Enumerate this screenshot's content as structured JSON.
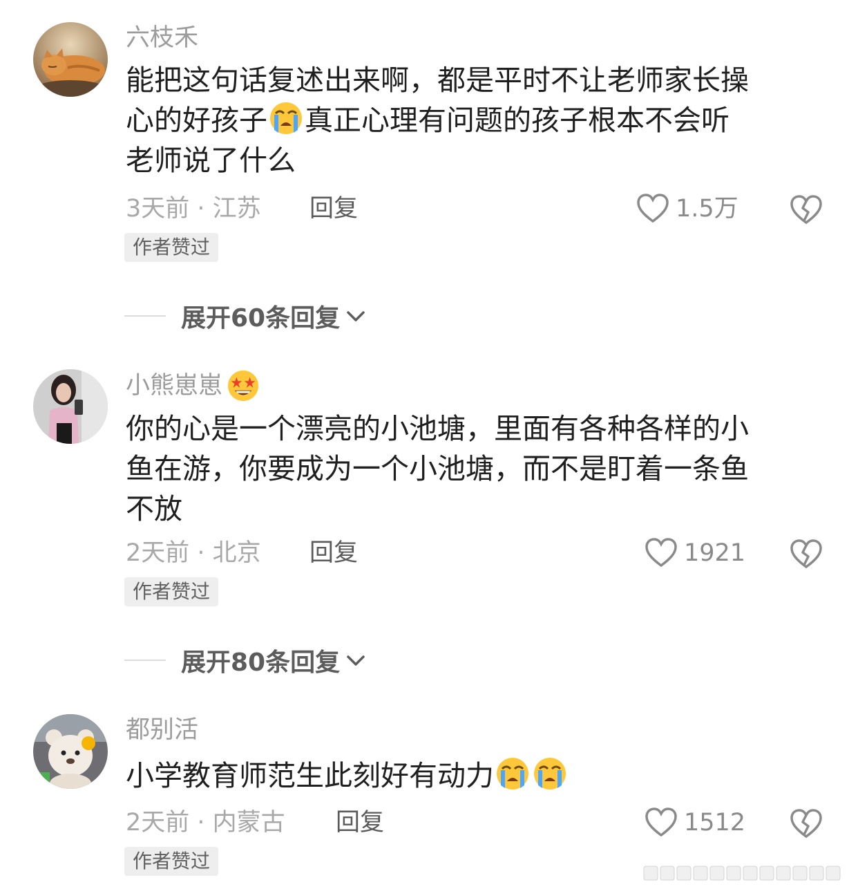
{
  "comments": [
    {
      "username": "六枝禾",
      "avatar_icon": "cat-sleeping-avatar",
      "text_lines": [
        "能把这句话复述出来啊，都是平时不让老师家长操",
        "心的好孩子",
        "真正心理有问题的孩子根本不会听",
        "老师说了什么"
      ],
      "meta": "3天前 · 江苏",
      "reply_label": "回复",
      "likes": "1.5万",
      "badge": "作者赞过",
      "expand_label": "展开60条回复"
    },
    {
      "username": "小熊崽崽",
      "username_emoji": "star-struck-emoji",
      "avatar_icon": "girl-selfie-avatar",
      "text_lines": [
        "你的心是一个漂亮的小池塘，里面有各种各样的小",
        "鱼在游，你要成为一个小池塘，而不是盯着一条鱼",
        "不放"
      ],
      "meta": "2天前 · 北京",
      "reply_label": "回复",
      "likes": "1921",
      "badge": "作者赞过",
      "expand_label": "展开80条回复"
    },
    {
      "username": "都别活",
      "avatar_icon": "teddy-bear-avatar",
      "text_lines": [
        "小学教育师范生此刻好有动力"
      ],
      "meta": "2天前 · 内蒙古",
      "reply_label": "回复",
      "likes": "1512",
      "badge": "作者赞过"
    }
  ],
  "icons": {
    "like": "heart-outline-icon",
    "dislike": "broken-heart-icon",
    "expand": "chevron-down-icon",
    "emoji_cry": "loudly-crying-emoji"
  },
  "colors": {
    "text_primary": "#1f1f1f",
    "text_secondary": "#9c9c9c",
    "badge_bg": "#eeeeee"
  }
}
